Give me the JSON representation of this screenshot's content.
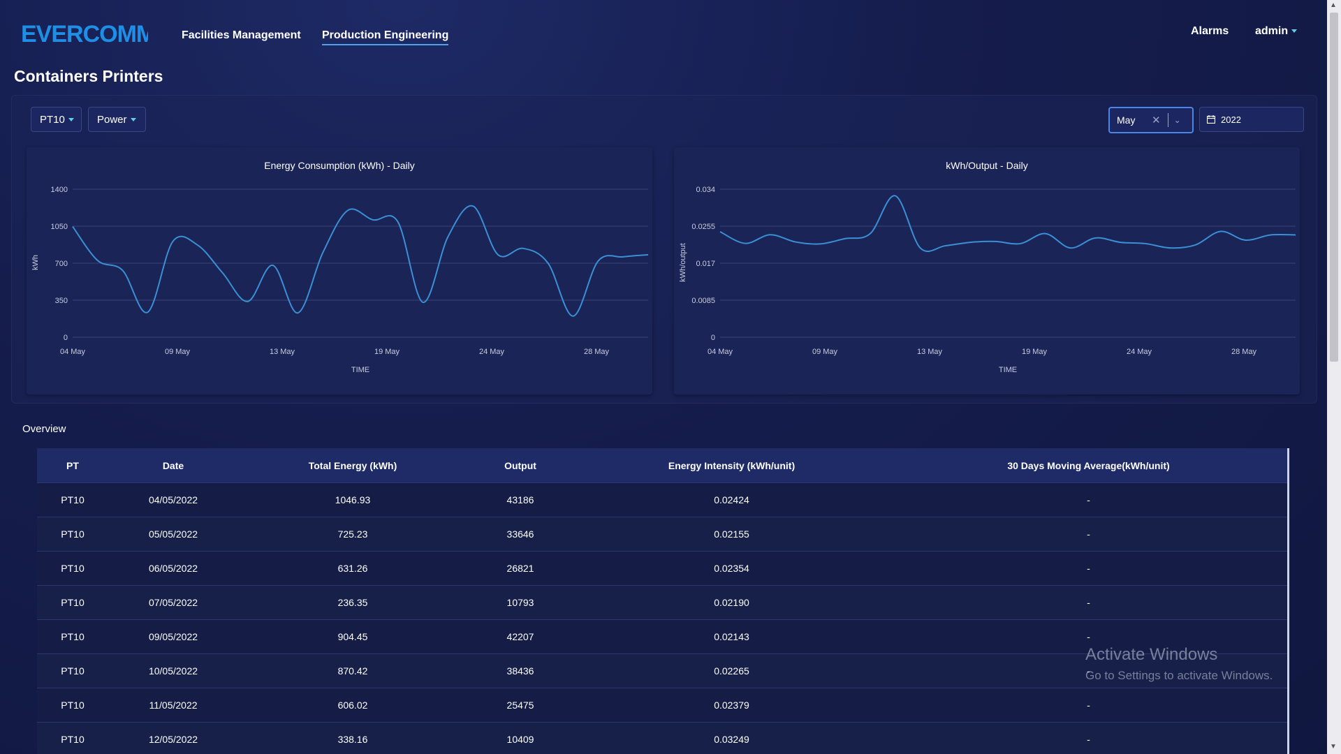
{
  "brand": {
    "logo_text": "EVERCOMM"
  },
  "nav": {
    "items": [
      "Facilities Management",
      "Production Engineering"
    ],
    "active": "Production Engineering"
  },
  "header_right": {
    "alarms": "Alarms",
    "user": "admin"
  },
  "page": {
    "title": "Containers Printers"
  },
  "filters": {
    "device": "PT10",
    "metric": "Power",
    "month": "May",
    "year": "2022"
  },
  "colors": {
    "accent": "#4ea3e8",
    "line": "#3a8fd6"
  },
  "charts": [
    {
      "title": "Energy Consumption (kWh) - Daily",
      "ylabel": "kWh",
      "xlabel": "TIME",
      "yticks": [
        "1400",
        "1050",
        "700",
        "350",
        "0"
      ],
      "xticks": [
        "04 May",
        "09 May",
        "13 May",
        "19 May",
        "24 May",
        "28 May"
      ]
    },
    {
      "title": "kWh/Output - Daily",
      "ylabel": "kWh/output",
      "xlabel": "TIME",
      "yticks": [
        "0.034",
        "0.0255",
        "0.017",
        "0.0085",
        "0"
      ],
      "xticks": [
        "04 May",
        "09 May",
        "13 May",
        "19 May",
        "24 May",
        "28 May"
      ]
    }
  ],
  "chart_data": [
    {
      "type": "line",
      "title": "Energy Consumption (kWh) - Daily",
      "xlabel": "TIME",
      "ylabel": "kWh",
      "ylim": [
        0,
        1400
      ],
      "x": [
        "04 May",
        "05 May",
        "06 May",
        "07 May",
        "09 May",
        "10 May",
        "11 May",
        "12 May",
        "13 May",
        "14 May",
        "16 May",
        "17 May",
        "18 May",
        "19 May",
        "20 May",
        "21 May",
        "23 May",
        "24 May",
        "25 May",
        "26 May",
        "27 May",
        "28 May",
        "30 May",
        "31 May"
      ],
      "values": [
        1046.93,
        725.23,
        631.26,
        236.35,
        904.45,
        870.42,
        606.02,
        338.16,
        680,
        230,
        800,
        1200,
        1110,
        1090,
        330,
        950,
        1240,
        780,
        840,
        700,
        200,
        720,
        760,
        780
      ]
    },
    {
      "type": "line",
      "title": "kWh/Output - Daily",
      "xlabel": "TIME",
      "ylabel": "kWh/output",
      "ylim": [
        0,
        0.034
      ],
      "x": [
        "04 May",
        "05 May",
        "06 May",
        "07 May",
        "09 May",
        "10 May",
        "11 May",
        "12 May",
        "13 May",
        "14 May",
        "16 May",
        "17 May",
        "18 May",
        "19 May",
        "20 May",
        "21 May",
        "23 May",
        "24 May",
        "25 May",
        "26 May",
        "27 May",
        "28 May",
        "30 May",
        "31 May"
      ],
      "values": [
        0.02424,
        0.02155,
        0.02354,
        0.0219,
        0.02143,
        0.02265,
        0.02379,
        0.03249,
        0.0205,
        0.021,
        0.0218,
        0.022,
        0.0215,
        0.0238,
        0.0205,
        0.0228,
        0.0218,
        0.0215,
        0.0205,
        0.0212,
        0.0243,
        0.0223,
        0.0235,
        0.0235
      ]
    }
  ],
  "overview": {
    "label": "Overview",
    "columns": [
      "PT",
      "Date",
      "Total Energy (kWh)",
      "Output",
      "Energy Intensity (kWh/unit)",
      "30 Days Moving Average(kWh/unit)"
    ],
    "rows": [
      [
        "PT10",
        "04/05/2022",
        "1046.93",
        "43186",
        "0.02424",
        "-"
      ],
      [
        "PT10",
        "05/05/2022",
        "725.23",
        "33646",
        "0.02155",
        "-"
      ],
      [
        "PT10",
        "06/05/2022",
        "631.26",
        "26821",
        "0.02354",
        "-"
      ],
      [
        "PT10",
        "07/05/2022",
        "236.35",
        "10793",
        "0.02190",
        "-"
      ],
      [
        "PT10",
        "09/05/2022",
        "904.45",
        "42207",
        "0.02143",
        "-"
      ],
      [
        "PT10",
        "10/05/2022",
        "870.42",
        "38436",
        "0.02265",
        "-"
      ],
      [
        "PT10",
        "11/05/2022",
        "606.02",
        "25475",
        "0.02379",
        "-"
      ],
      [
        "PT10",
        "12/05/2022",
        "338.16",
        "10409",
        "0.03249",
        "-"
      ]
    ]
  },
  "watermark": {
    "line1": "Activate Windows",
    "line2": "Go to Settings to activate Windows."
  }
}
